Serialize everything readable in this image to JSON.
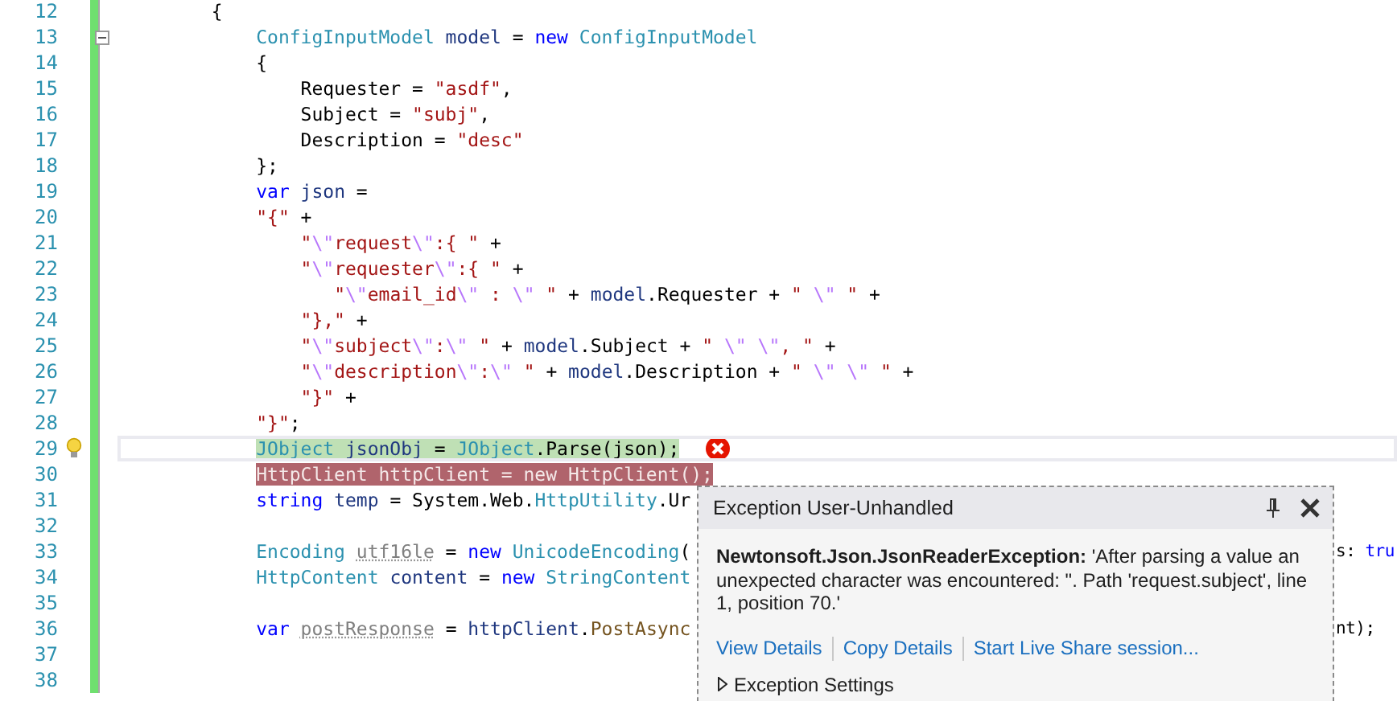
{
  "editor": {
    "lines": [
      {
        "number": "12",
        "current": false,
        "error": false,
        "tokens": [
          {
            "kind": "plain",
            "text": "        {"
          }
        ]
      },
      {
        "number": "13",
        "current": false,
        "error": false,
        "fold": true,
        "tokens": [
          {
            "kind": "type",
            "text": "            ConfigInputModel "
          },
          {
            "kind": "local",
            "text": "model"
          },
          {
            "kind": "plain",
            "text": " = "
          },
          {
            "kind": "kw",
            "text": "new"
          },
          {
            "kind": "type",
            "text": " ConfigInputModel"
          }
        ]
      },
      {
        "number": "14",
        "current": false,
        "error": false,
        "tokens": [
          {
            "kind": "plain",
            "text": "            {"
          }
        ]
      },
      {
        "number": "15",
        "current": false,
        "error": false,
        "tokens": [
          {
            "kind": "plain",
            "text": "                Requester = "
          },
          {
            "kind": "str",
            "text": "\"asdf\""
          },
          {
            "kind": "plain",
            "text": ","
          }
        ]
      },
      {
        "number": "16",
        "current": false,
        "error": false,
        "tokens": [
          {
            "kind": "plain",
            "text": "                Subject = "
          },
          {
            "kind": "str",
            "text": "\"subj\""
          },
          {
            "kind": "plain",
            "text": ","
          }
        ]
      },
      {
        "number": "17",
        "current": false,
        "error": false,
        "tokens": [
          {
            "kind": "plain",
            "text": "                Description = "
          },
          {
            "kind": "str",
            "text": "\"desc\""
          }
        ]
      },
      {
        "number": "18",
        "current": false,
        "error": false,
        "tokens": [
          {
            "kind": "plain",
            "text": "            };"
          }
        ]
      },
      {
        "number": "19",
        "current": false,
        "error": false,
        "tokens": [
          {
            "kind": "kw",
            "text": "            var"
          },
          {
            "kind": "local",
            "text": " json"
          },
          {
            "kind": "plain",
            "text": " ="
          }
        ]
      },
      {
        "number": "20",
        "current": false,
        "error": false,
        "tokens": [
          {
            "kind": "str",
            "text": "            \"{\""
          },
          {
            "kind": "plain",
            "text": " +"
          }
        ]
      },
      {
        "number": "21",
        "current": false,
        "error": false,
        "tokens": [
          {
            "kind": "str",
            "text": "                \""
          },
          {
            "kind": "esc",
            "text": "\\\""
          },
          {
            "kind": "str",
            "text": "request"
          },
          {
            "kind": "esc",
            "text": "\\\""
          },
          {
            "kind": "str",
            "text": ":{ \""
          },
          {
            "kind": "plain",
            "text": " +"
          }
        ]
      },
      {
        "number": "22",
        "current": false,
        "error": false,
        "tokens": [
          {
            "kind": "str",
            "text": "                \""
          },
          {
            "kind": "esc",
            "text": "\\\""
          },
          {
            "kind": "str",
            "text": "requester"
          },
          {
            "kind": "esc",
            "text": "\\\""
          },
          {
            "kind": "str",
            "text": ":{ \""
          },
          {
            "kind": "plain",
            "text": " +"
          }
        ]
      },
      {
        "number": "23",
        "current": false,
        "error": false,
        "tokens": [
          {
            "kind": "str",
            "text": "                   \""
          },
          {
            "kind": "esc",
            "text": "\\\""
          },
          {
            "kind": "str",
            "text": "email_id"
          },
          {
            "kind": "esc",
            "text": "\\\""
          },
          {
            "kind": "str",
            "text": " : "
          },
          {
            "kind": "esc",
            "text": "\\\""
          },
          {
            "kind": "str",
            "text": " \""
          },
          {
            "kind": "plain",
            "text": " + "
          },
          {
            "kind": "local",
            "text": "model"
          },
          {
            "kind": "plain",
            "text": ".Requester + "
          },
          {
            "kind": "str",
            "text": "\" "
          },
          {
            "kind": "esc",
            "text": "\\\""
          },
          {
            "kind": "str",
            "text": " \""
          },
          {
            "kind": "plain",
            "text": " +"
          }
        ]
      },
      {
        "number": "24",
        "current": false,
        "error": false,
        "tokens": [
          {
            "kind": "str",
            "text": "                \"},\""
          },
          {
            "kind": "plain",
            "text": " +"
          }
        ]
      },
      {
        "number": "25",
        "current": false,
        "error": false,
        "tokens": [
          {
            "kind": "str",
            "text": "                \""
          },
          {
            "kind": "esc",
            "text": "\\\""
          },
          {
            "kind": "str",
            "text": "subject"
          },
          {
            "kind": "esc",
            "text": "\\\""
          },
          {
            "kind": "str",
            "text": ":"
          },
          {
            "kind": "esc",
            "text": "\\\""
          },
          {
            "kind": "str",
            "text": " \""
          },
          {
            "kind": "plain",
            "text": " + "
          },
          {
            "kind": "local",
            "text": "model"
          },
          {
            "kind": "plain",
            "text": ".Subject + "
          },
          {
            "kind": "str",
            "text": "\" "
          },
          {
            "kind": "esc",
            "text": "\\\" \\\""
          },
          {
            "kind": "str",
            "text": ", \""
          },
          {
            "kind": "plain",
            "text": " +"
          }
        ]
      },
      {
        "number": "26",
        "current": false,
        "error": false,
        "tokens": [
          {
            "kind": "str",
            "text": "                \""
          },
          {
            "kind": "esc",
            "text": "\\\""
          },
          {
            "kind": "str",
            "text": "description"
          },
          {
            "kind": "esc",
            "text": "\\\""
          },
          {
            "kind": "str",
            "text": ":"
          },
          {
            "kind": "esc",
            "text": "\\\""
          },
          {
            "kind": "str",
            "text": " \""
          },
          {
            "kind": "plain",
            "text": " + "
          },
          {
            "kind": "local",
            "text": "model"
          },
          {
            "kind": "plain",
            "text": ".Description + "
          },
          {
            "kind": "str",
            "text": "\" "
          },
          {
            "kind": "esc",
            "text": "\\\" \\\""
          },
          {
            "kind": "str",
            "text": " \""
          },
          {
            "kind": "plain",
            "text": " +"
          }
        ]
      },
      {
        "number": "27",
        "current": false,
        "error": false,
        "tokens": [
          {
            "kind": "str",
            "text": "                \"}\""
          },
          {
            "kind": "plain",
            "text": " +"
          }
        ]
      },
      {
        "number": "28",
        "current": false,
        "error": false,
        "tokens": [
          {
            "kind": "str",
            "text": "            \"}\""
          },
          {
            "kind": "plain",
            "text": ";"
          }
        ]
      },
      {
        "number": "29",
        "current": true,
        "error": false,
        "tokens": [
          {
            "kind": "type",
            "text": "            JObject"
          },
          {
            "kind": "local",
            "text": " jsonObj"
          },
          {
            "kind": "plain",
            "text": " = "
          },
          {
            "kind": "type",
            "text": "JObject"
          },
          {
            "kind": "plain",
            "text": ".Parse(json);"
          }
        ]
      },
      {
        "number": "30",
        "current": false,
        "error": true,
        "tokens": [
          {
            "kind": "type",
            "text": "            HttpClient httpClient = new HttpClient();"
          }
        ]
      },
      {
        "number": "31",
        "current": false,
        "error": false,
        "tokens": [
          {
            "kind": "kw",
            "text": "            string"
          },
          {
            "kind": "local",
            "text": " temp"
          },
          {
            "kind": "plain",
            "text": " = System.Web."
          },
          {
            "kind": "type",
            "text": "HttpUtility"
          },
          {
            "kind": "plain",
            "text": ".Ur"
          }
        ]
      },
      {
        "number": "32",
        "current": false,
        "error": false
      },
      {
        "number": "33",
        "current": false,
        "error": false,
        "tokens": [
          {
            "kind": "type",
            "text": "            Encoding "
          },
          {
            "kind": "unused",
            "text": "utf16le"
          },
          {
            "kind": "plain",
            "text": " = "
          },
          {
            "kind": "kw",
            "text": "new"
          },
          {
            "kind": "type",
            "text": " UnicodeEncoding"
          },
          {
            "kind": "plain",
            "text": "("
          }
        ],
        "tail": [
          {
            "kind": "plain",
            "text": "s: "
          },
          {
            "kind": "kw",
            "text": "tru"
          }
        ]
      },
      {
        "number": "34",
        "current": false,
        "error": false,
        "tokens": [
          {
            "kind": "type",
            "text": "            HttpContent"
          },
          {
            "kind": "local",
            "text": " content"
          },
          {
            "kind": "plain",
            "text": " = "
          },
          {
            "kind": "kw",
            "text": "new"
          },
          {
            "kind": "type",
            "text": " StringContent"
          }
        ]
      },
      {
        "number": "35",
        "current": false,
        "error": false
      },
      {
        "number": "36",
        "current": false,
        "error": false,
        "tokens": [
          {
            "kind": "kw",
            "text": "            var "
          },
          {
            "kind": "unused",
            "text": "postResponse"
          },
          {
            "kind": "plain",
            "text": " = "
          },
          {
            "kind": "local",
            "text": "httpClient"
          },
          {
            "kind": "plain",
            "text": "."
          },
          {
            "kind": "method",
            "text": "PostAsync"
          }
        ],
        "tail": [
          {
            "kind": "plain",
            "text": "nt);"
          }
        ]
      },
      {
        "number": "37",
        "current": false,
        "error": false
      },
      {
        "number": "38",
        "current": false,
        "error": false
      }
    ]
  },
  "exception_popup": {
    "title": "Exception User-Unhandled",
    "message": "**Newtonsoft.Json.JsonReaderException:** 'After parsing a value an unexpected character was encountered: \". Path 'request.subject', line 1, position 70.'",
    "links": [
      "View Details",
      "Copy Details",
      "Start Live Share session..."
    ],
    "settings": {
      "label": "Exception Settings",
      "expanded": false
    }
  }
}
